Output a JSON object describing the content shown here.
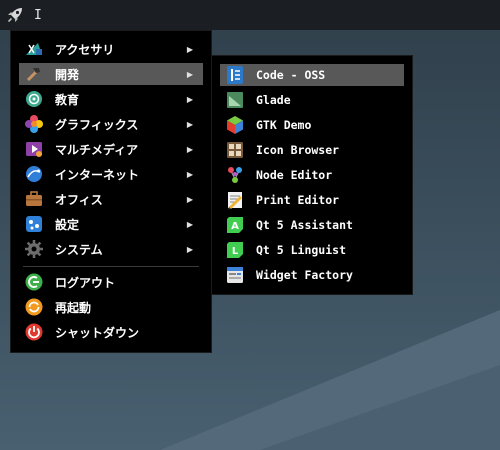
{
  "panel": {
    "launcher_icon": "rocket-icon",
    "cursor_text": "I"
  },
  "main_menu": {
    "items": [
      {
        "label": "アクセサリ",
        "icon": "accessories-icon",
        "has_submenu": true
      },
      {
        "label": "開発",
        "icon": "development-icon",
        "has_submenu": true,
        "active": true
      },
      {
        "label": "教育",
        "icon": "education-icon",
        "has_submenu": true
      },
      {
        "label": "グラフィックス",
        "icon": "graphics-icon",
        "has_submenu": true
      },
      {
        "label": "マルチメディア",
        "icon": "multimedia-icon",
        "has_submenu": true
      },
      {
        "label": "インターネット",
        "icon": "internet-icon",
        "has_submenu": true
      },
      {
        "label": "オフィス",
        "icon": "office-icon",
        "has_submenu": true
      },
      {
        "label": "設定",
        "icon": "settings-icon",
        "has_submenu": true
      },
      {
        "label": "システム",
        "icon": "system-icon",
        "has_submenu": true
      }
    ],
    "session_items": [
      {
        "label": "ログアウト",
        "icon": "logout-icon"
      },
      {
        "label": "再起動",
        "icon": "reboot-icon"
      },
      {
        "label": "シャットダウン",
        "icon": "shutdown-icon"
      }
    ],
    "arrow": "▶"
  },
  "sub_menu": {
    "items": [
      {
        "label": "Code - OSS",
        "icon": "code-oss-icon",
        "active": true
      },
      {
        "label": "Glade",
        "icon": "glade-icon"
      },
      {
        "label": "GTK Demo",
        "icon": "gtk-demo-icon"
      },
      {
        "label": "Icon Browser",
        "icon": "icon-browser-icon"
      },
      {
        "label": "Node Editor",
        "icon": "node-editor-icon"
      },
      {
        "label": "Print Editor",
        "icon": "print-editor-icon"
      },
      {
        "label": "Qt 5 Assistant",
        "icon": "qt-assistant-icon"
      },
      {
        "label": "Qt 5 Linguist",
        "icon": "qt-linguist-icon"
      },
      {
        "label": "Widget Factory",
        "icon": "widget-factory-icon"
      }
    ]
  },
  "colors": {
    "menu_bg": "#000000",
    "highlight": "#585858",
    "panel_bg": "#1b1e22"
  }
}
